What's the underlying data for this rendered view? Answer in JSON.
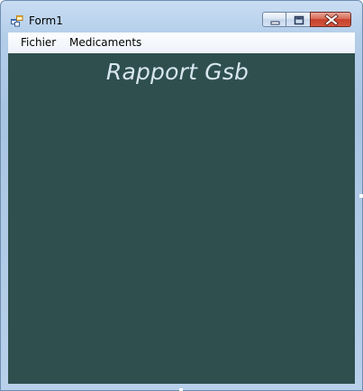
{
  "window": {
    "title": "Form1",
    "icon": "windows-form-icon",
    "buttons": {
      "minimize": "minimize-icon",
      "maximize": "maximize-icon",
      "close": "close-icon"
    }
  },
  "menu": {
    "items": [
      {
        "label": "Fichier"
      },
      {
        "label": "Medicaments"
      }
    ]
  },
  "content": {
    "title": "Rapport Gsb",
    "background_color": "#2f4f4f",
    "title_color": "#d8e6f0"
  }
}
